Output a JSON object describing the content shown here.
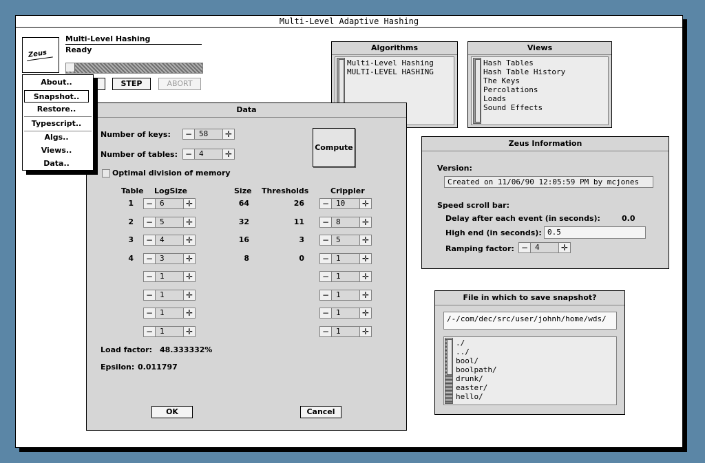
{
  "window_title": "Multi-Level Adaptive Hashing",
  "control": {
    "logo": "Zeus",
    "algorithm": "Multi-Level Hashing",
    "status": "Ready",
    "go_label": "GO",
    "step_label": "STEP",
    "abort_label": "ABORT"
  },
  "menu": [
    "About..",
    "Snapshot..",
    "Restore..",
    "Typescript..",
    "Algs..",
    "Views..",
    "Data.."
  ],
  "algorithms": {
    "title": "Algorithms",
    "items": [
      "Multi-Level Hashing",
      "MULTI-LEVEL HASHING"
    ]
  },
  "views": {
    "title": "Views",
    "items": [
      "Hash Tables",
      "Hash Table History",
      "The Keys",
      "Percolations",
      "Loads",
      "Sound Effects"
    ]
  },
  "zeus_info": {
    "title": "Zeus Information",
    "version_label": "Version:",
    "version_value": "Created on 11/06/90 12:05:59 PM by mcjones",
    "speed_label": "Speed scroll bar:",
    "delay_label": "Delay after each event (in seconds):",
    "delay_value": "0.0",
    "highend_label": "High end (in seconds):",
    "highend_value": "0.5",
    "ramp_label": "Ramping factor:",
    "ramp_value": "4"
  },
  "snapshot": {
    "title": "File in which to save snapshot?",
    "path": "/-/com/dec/src/user/johnh/home/wds/",
    "files": [
      "./",
      "../",
      "bool/",
      "boolpath/",
      "drunk/",
      "easter/",
      "hello/"
    ]
  },
  "data": {
    "title": "Data",
    "keys_label": "Number of keys:",
    "keys_value": "58",
    "tables_label": "Number of tables:",
    "tables_value": "4",
    "compute_label": "Compute",
    "optimal_label": "Optimal division of memory",
    "headers": {
      "table": "Table",
      "logsize": "LogSize",
      "size": "Size",
      "thresholds": "Thresholds",
      "crippler": "Crippler"
    },
    "rows": [
      {
        "table": "1",
        "logsize": "6",
        "size": "64",
        "threshold": "26",
        "crippler": "10"
      },
      {
        "table": "2",
        "logsize": "5",
        "size": "32",
        "threshold": "11",
        "crippler": "8"
      },
      {
        "table": "3",
        "logsize": "4",
        "size": "16",
        "threshold": "3",
        "crippler": "5"
      },
      {
        "table": "4",
        "logsize": "3",
        "size": "8",
        "threshold": "0",
        "crippler": "1"
      },
      {
        "table": "",
        "logsize": "1",
        "size": "",
        "threshold": "",
        "crippler": "1"
      },
      {
        "table": "",
        "logsize": "1",
        "size": "",
        "threshold": "",
        "crippler": "1"
      },
      {
        "table": "",
        "logsize": "1",
        "size": "",
        "threshold": "",
        "crippler": "1"
      },
      {
        "table": "",
        "logsize": "1",
        "size": "",
        "threshold": "",
        "crippler": "1"
      }
    ],
    "load_factor_label": "Load factor:",
    "load_factor_value": "48.333332%",
    "epsilon_label": "Epsilon:",
    "epsilon_value": "0.011797",
    "ok_label": "OK",
    "cancel_label": "Cancel"
  },
  "icons": {
    "minus": "minus-icon",
    "plus": "plus-icon"
  }
}
